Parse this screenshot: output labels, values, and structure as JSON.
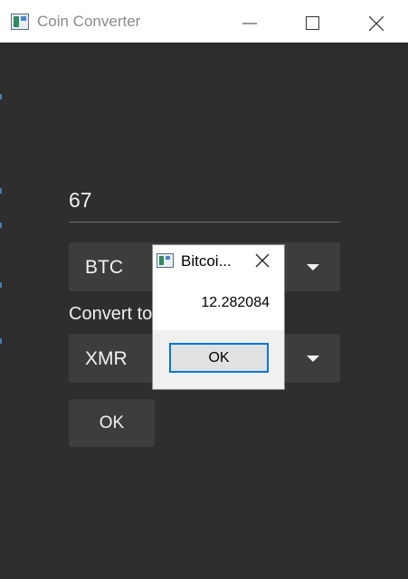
{
  "window": {
    "title": "Coin Converter",
    "controls": {
      "minimize": "minimize-icon",
      "maximize": "maximize-icon",
      "close": "close-icon"
    }
  },
  "form": {
    "amount_value": "67",
    "from_currency": "BTC",
    "convert_to_label": "Convert to",
    "to_currency": "XMR",
    "ok_label": "OK"
  },
  "dialog": {
    "title": "Bitcoi...",
    "message": "12.282084",
    "ok_label": "OK"
  },
  "colors": {
    "background": "#2e2e2e",
    "control": "#3d3d3d",
    "accent": "#0078d7"
  }
}
